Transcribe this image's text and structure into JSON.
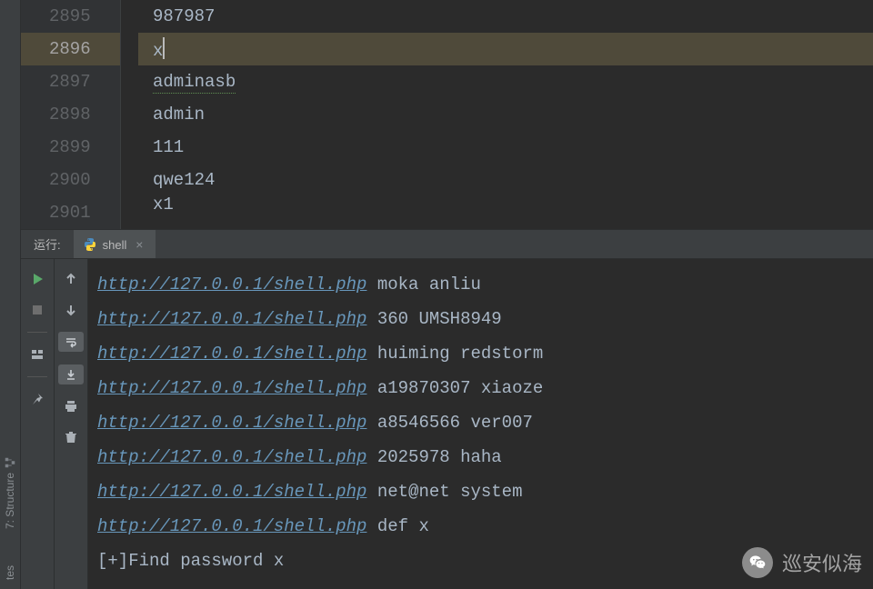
{
  "editor": {
    "lines": [
      {
        "num": "2895",
        "text": "987987",
        "active": false
      },
      {
        "num": "2896",
        "text": "x",
        "active": true,
        "caret": true
      },
      {
        "num": "2897",
        "text": "adminasb",
        "active": false,
        "wavy": true
      },
      {
        "num": "2898",
        "text": "admin",
        "active": false
      },
      {
        "num": "2899",
        "text": "111",
        "active": false
      },
      {
        "num": "2900",
        "text": "qwe124",
        "active": false
      },
      {
        "num": "2901",
        "text": "x1",
        "active": false,
        "partial": true
      }
    ]
  },
  "run": {
    "label": "运行:",
    "tab": {
      "name": "shell",
      "icon": "python-icon"
    },
    "toolbar_a": [
      "play",
      "stop",
      "sep",
      "layout",
      "sep",
      "pin"
    ],
    "toolbar_b": [
      "up",
      "down",
      "wrap",
      "scroll-end",
      "print",
      "trash"
    ]
  },
  "console": {
    "url": "http://127.0.0.1/shell.php",
    "lines": [
      {
        "tail": " moka anliu"
      },
      {
        "tail": " 360 UMSH8949"
      },
      {
        "tail": " huiming redstorm"
      },
      {
        "tail": " a19870307 xiaoze"
      },
      {
        "tail": " a8546566 ver007"
      },
      {
        "tail": " 2025978 haha"
      },
      {
        "tail": " net@net system"
      },
      {
        "tail": " def x"
      }
    ],
    "final": "[+]Find password x"
  },
  "sidebar": {
    "label": "7: Structure",
    "bottom": "tes"
  },
  "watermark": {
    "text": "巡安似海"
  }
}
